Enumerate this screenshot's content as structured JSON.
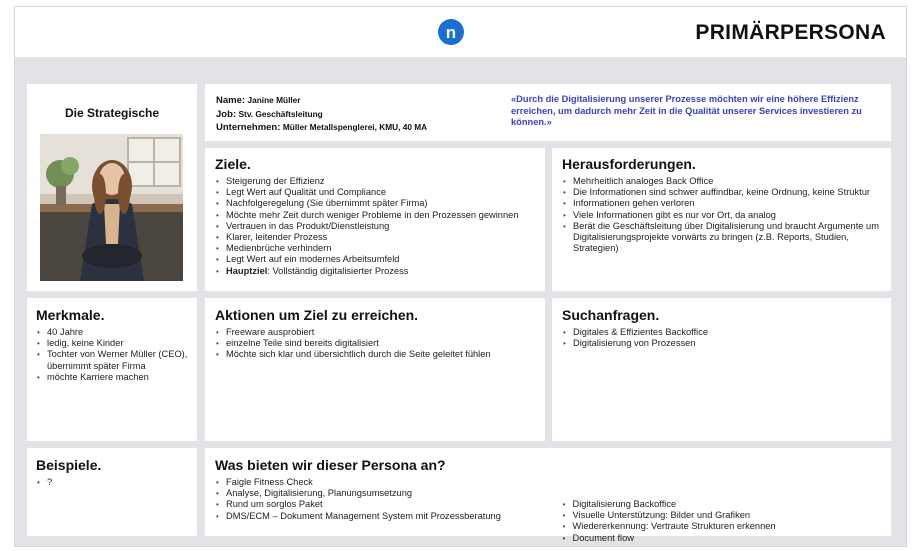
{
  "header": {
    "logo_letter": "n",
    "title": "PRIMÄRPERSONA",
    "brand_color": "#1b6fd1"
  },
  "persona": {
    "label": "Die Strategische",
    "name_label": "Name:",
    "name": "Janine Müller",
    "job_label": "Job:",
    "job": "Stv. Geschäftsleitung",
    "company_label": "Unternehmen:",
    "company": "Müller Metallspenglerei, KMU, 40 MA",
    "quote": "«Durch die Digitalisierung unserer Prozesse möchten wir eine höhere Effizienz erreichen, um dadurch mehr Zeit in die Qualität unserer Services investieren zu können.»",
    "quote_color": "#3b41c4"
  },
  "ziele": {
    "title": "Ziele.",
    "items": [
      "Steigerung der Effizienz",
      "Legt Wert auf Qualität und Compliance",
      "Nachfolgeregelung (Sie übernimmt später Firma)",
      "Möchte mehr Zeit durch weniger Probleme in den Prozessen gewinnen",
      "Vertrauen in das Produkt/Dienstleistung",
      "Klarer, leitender Prozess",
      "Medienbrüche verhindern",
      "Legt Wert auf ein modernes Arbeitsumfeld"
    ],
    "main_goal_label": "Hauptziel",
    "main_goal": ": Vollständig digitalisierter Prozess"
  },
  "herausforderungen": {
    "title": "Herausforderungen.",
    "items": [
      "Mehrheitlich analoges Back Office",
      "Die Informationen sind schwer auffindbar, keine Ordnung, keine Struktur",
      "Informationen gehen verloren",
      "Viele Informationen gibt es nur vor Ort, da analog",
      "Berät die Geschäftsleitung über Digitalisierung und braucht Argumente um Digitalisierungsprojekte vorwärts zu bringen (z.B. Reports, Studien, Strategien)"
    ]
  },
  "merkmale": {
    "title": "Merkmale.",
    "items": [
      "40 Jahre",
      "ledig, keine Kinder",
      "Tochter von Werner Müller (CEO), übernimmt später Firma",
      "möchte Karriere machen"
    ]
  },
  "aktionen": {
    "title": "Aktionen um Ziel zu erreichen.",
    "items": [
      "Freeware ausprobiert",
      "einzelne Teile sind bereits digitalisiert",
      "Möchte sich klar und übersichtlich durch die Seite geleitet fühlen"
    ]
  },
  "suchanfragen": {
    "title": "Suchanfragen.",
    "items": [
      "Digitales & Effizientes Backoffice",
      "Digitalisierung von Prozessen"
    ]
  },
  "beispiele": {
    "title": "Beispiele.",
    "items": [
      "?"
    ]
  },
  "bieten": {
    "title": "Was bieten wir dieser Persona an?",
    "left_items": [
      "Faigle Fitness Check",
      "Analyse, Digitalisierung, Planungsumsetzung",
      "Rund um sorglos Paket",
      "DMS/ECM –  Dokument Management System mit Prozessberatung"
    ],
    "right_items": [
      "Digitalisierung Backoffice",
      "Visuelle Unterstützung: Bilder und Grafiken",
      "Wiedererkennung: Vertraute Strukturen erkennen",
      "Document flow"
    ]
  }
}
